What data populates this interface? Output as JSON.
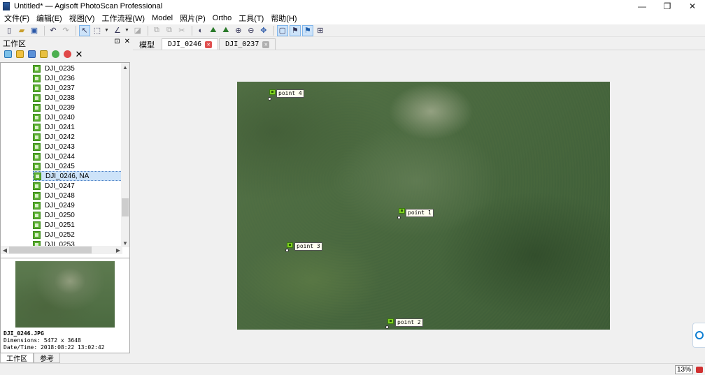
{
  "window": {
    "title": "Untitled* — Agisoft PhotoScan Professional",
    "min": "—",
    "max": "❐",
    "close": "✕"
  },
  "menu": [
    "文件(F)",
    "编辑(E)",
    "视图(V)",
    "工作流程(W)",
    "Model",
    "照片(P)",
    "Ortho",
    "工具(T)",
    "帮助(H)"
  ],
  "workspace": {
    "header": "工作区",
    "float_btn": "⊡",
    "close_btn": "✕",
    "items": [
      "DJI_0235",
      "DJI_0236",
      "DJI_0237",
      "DJI_0238",
      "DJI_0239",
      "DJI_0240",
      "DJI_0241",
      "DJI_0242",
      "DJI_0243",
      "DJI_0244",
      "DJI_0245",
      "DJI_0246, NA",
      "DJI_0247",
      "DJI_0248",
      "DJI_0249",
      "DJI_0250",
      "DJI_0251",
      "DJI_0252",
      "DJI_0253"
    ],
    "selected_index": 11
  },
  "preview": {
    "filename": "DJI_0246.JPG",
    "dimensions": "Dimensions: 5472 x 3648",
    "datetime": "Date/Time: 2018:08:22 13:02:42"
  },
  "bottom_tabs": [
    "工作区",
    "参考"
  ],
  "tabs": [
    {
      "label": "模型",
      "close": ""
    },
    {
      "label": "DJI_0246",
      "close": "✕"
    },
    {
      "label": "DJI_0237",
      "close": "✕"
    }
  ],
  "markers": [
    "point 4",
    "point 1",
    "point 3",
    "point 2"
  ],
  "status": {
    "zoom": "13%"
  },
  "colors": {
    "accent": "#cde3f9",
    "marker": "#7fd020",
    "tab_close_active": "#e05050"
  }
}
